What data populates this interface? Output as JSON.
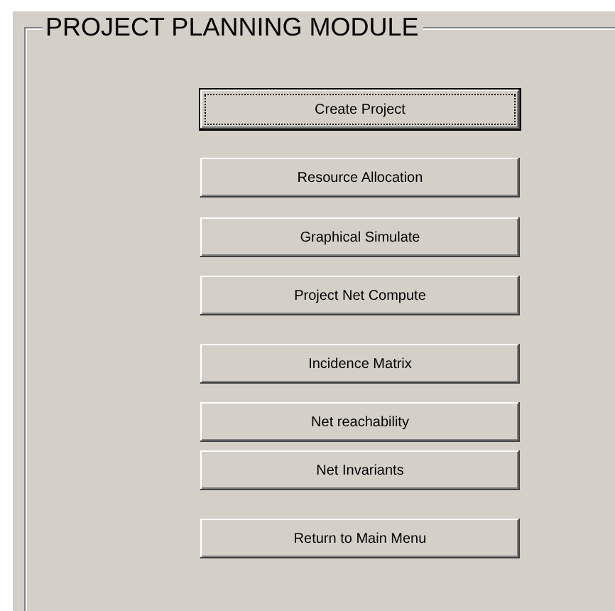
{
  "group": {
    "title": "PROJECT PLANNING MODULE"
  },
  "buttons": [
    {
      "label": "Create Project",
      "focused": true
    },
    {
      "label": "Resource Allocation",
      "focused": false
    },
    {
      "label": "Graphical Simulate",
      "focused": false
    },
    {
      "label": "Project Net Compute",
      "focused": false
    },
    {
      "label": "Incidence Matrix",
      "focused": false
    },
    {
      "label": "Net reachability",
      "focused": false
    },
    {
      "label": "Net Invariants",
      "focused": false
    },
    {
      "label": "Return to Main Menu",
      "focused": false
    }
  ]
}
